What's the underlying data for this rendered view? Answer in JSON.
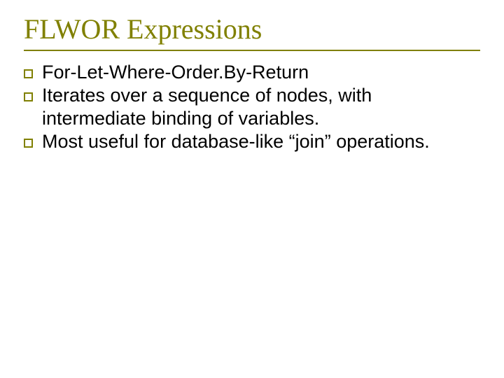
{
  "slide": {
    "title": "FLWOR Expressions",
    "bullets": [
      "For-Let-Where-Order.By-Return",
      "Iterates over a sequence of nodes, with intermediate binding of variables.",
      "Most useful for database-like “join” operations."
    ]
  }
}
